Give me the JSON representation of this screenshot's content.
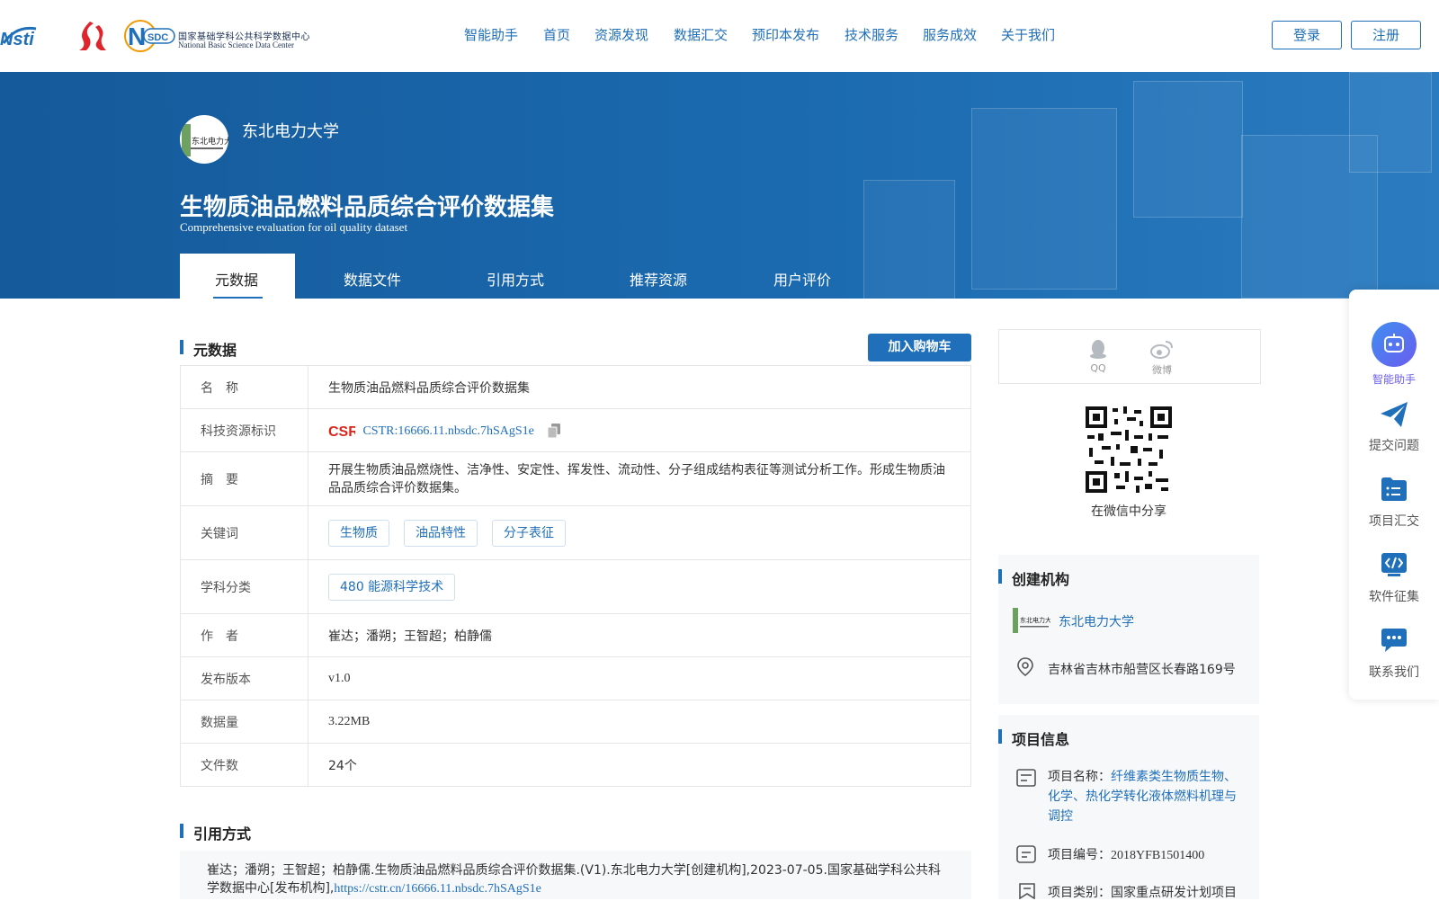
{
  "header": {
    "nav": [
      "智能助手",
      "首页",
      "资源发现",
      "数据汇交",
      "预印本发布",
      "技术服务",
      "服务成效",
      "关于我们"
    ],
    "login": "登录",
    "register": "注册",
    "nsdc_en": "National Basic Science Data Center",
    "nsdc_cn": "国家基础学科公共科学数据中心"
  },
  "banner": {
    "org_name": "东北电力大学",
    "title": "生物质油品燃料品质综合评价数据集",
    "subtitle": "Comprehensive evaluation for oil quality dataset",
    "tabs": [
      "元数据",
      "数据文件",
      "引用方式",
      "推荐资源",
      "用户评价"
    ]
  },
  "metadata": {
    "section_title": "元数据",
    "cart_button": "加入购物车",
    "rows": {
      "name_label": "名　称",
      "name_value": "生物质油品燃料品质综合评价数据集",
      "cstr_label": "科技资源标识",
      "cstr_value": "CSTR:16666.11.nbsdc.7hSAgS1e",
      "abstract_label": "摘　要",
      "abstract_value": "开展生物质油品燃烧性、洁净性、安定性、挥发性、流动性、分子组成结构表征等测试分析工作。形成生物质油品品质综合评价数据集。",
      "keywords_label": "关键词",
      "keywords": [
        "生物质",
        "油品特性",
        "分子表征"
      ],
      "subject_label": "学科分类",
      "subject_value": "480 能源科学技术",
      "author_label": "作　者",
      "author_value": "崔达；潘朔；王智超；柏静儒",
      "version_label": "发布版本",
      "version_value": "v1.0",
      "size_label": "数据量",
      "size_value": "3.22MB",
      "files_label": "文件数",
      "files_value": "24个"
    }
  },
  "citation": {
    "section_title": "引用方式",
    "text": "崔达；潘朔；王智超；柏静儒.生物质油品燃料品质综合评价数据集.(V1).东北电力大学[创建机构],2023-07-05.国家基础学科公共科学数据中心[发布机构],",
    "link": "https://cstr.cn/16666.11.nbsdc.7hSAgS1e"
  },
  "share": {
    "qq": "QQ",
    "weibo": "微博",
    "wechat": "在微信中分享"
  },
  "creator": {
    "section_title": "创建机构",
    "org": "东北电力大学",
    "address": "吉林省吉林市船营区长春路169号"
  },
  "project": {
    "section_title": "项目信息",
    "name_label": "项目名称：",
    "name_value": "纤维素类生物质生物、化学、热化学转化液体燃料机理与调控",
    "code_label": "项目编号：",
    "code_value": "2018YFB1501400",
    "type_label": "项目类别：",
    "type_value": "国家重点研发计划项目"
  },
  "sidebar": [
    "智能助手",
    "提交问题",
    "项目汇交",
    "软件征集",
    "联系我们"
  ],
  "colors": {
    "primary": "#1f6fba",
    "banner": "#1b6ab0",
    "assistant": "#7b6cf0"
  }
}
